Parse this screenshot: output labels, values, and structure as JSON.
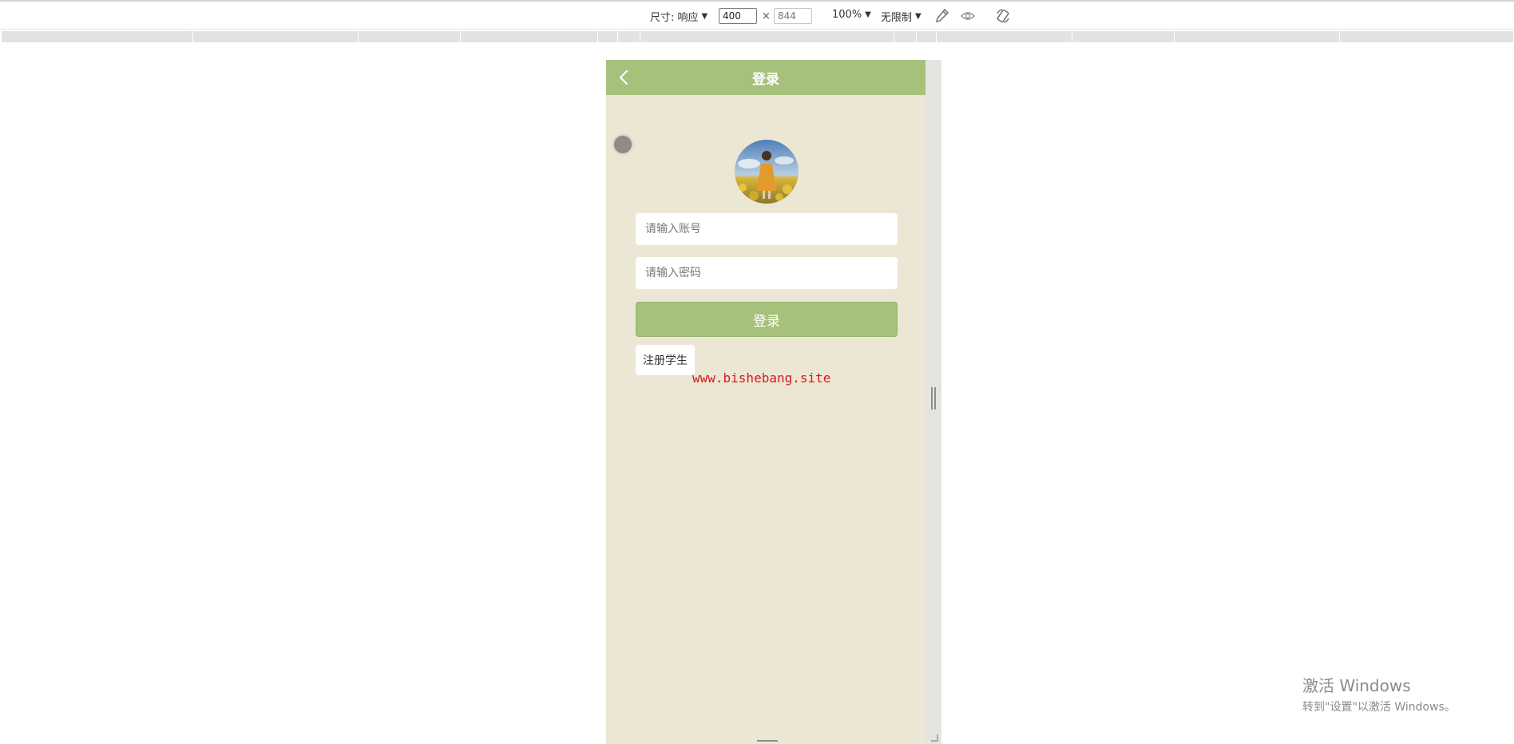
{
  "devtools": {
    "size_label": "尺寸: 响应",
    "width_value": "400",
    "times_sign": "×",
    "height_placeholder": "844",
    "zoom_label": "100%",
    "throttle_label": "无限制",
    "icons": [
      "dropdown-caret-icon",
      "eyedropper-icon",
      "eye-icon",
      "rotate-icon"
    ]
  },
  "app": {
    "header_title": "登录",
    "account_placeholder": "请输入账号",
    "password_placeholder": "请输入密码",
    "login_button": "登录",
    "register_link": "注册学生",
    "watermark": "www.bishebang.site",
    "colors": {
      "accent": "#a6c17b",
      "background": "#ece6d4",
      "watermark": "#d51a1a"
    }
  },
  "os_watermark": {
    "title": "激活 Windows",
    "subtitle": "转到\"设置\"以激活 Windows。"
  }
}
